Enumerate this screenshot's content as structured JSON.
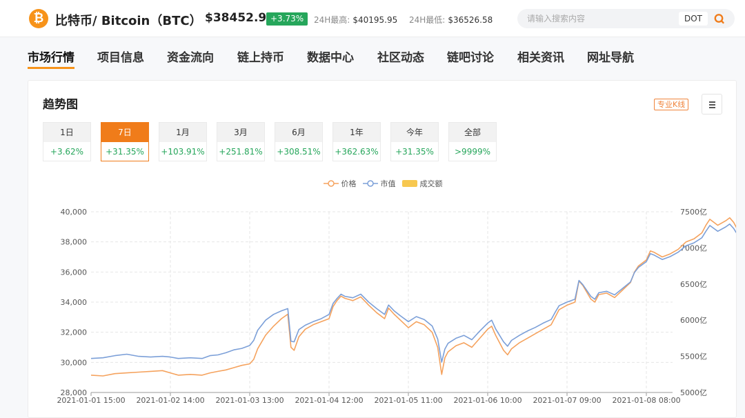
{
  "header": {
    "logo_symbol": "₿",
    "coin_name": "比特币/ Bitcoin（BTC）",
    "price": "$38452.91",
    "change": "+3.73%",
    "high_label": "24H最高:",
    "high_value": "$40195.95",
    "low_label": "24H最低:",
    "low_value": "$36526.58",
    "search_placeholder": "请输入搜索内容",
    "search_coin": "DOT",
    "search_icon": "search-icon"
  },
  "nav": {
    "items": [
      "市场行情",
      "项目信息",
      "资金流向",
      "链上持币",
      "数据中心",
      "社区动态",
      "链吧讨论",
      "相关资讯",
      "网址导航"
    ]
  },
  "panel": {
    "title": "趋势图",
    "kline_label": "专业K线",
    "menu_icon": "menu-icon"
  },
  "ranges": [
    {
      "label": "1日",
      "change": "+3.62%"
    },
    {
      "label": "7日",
      "change": "+31.35%",
      "active": true
    },
    {
      "label": "1月",
      "change": "+103.91%"
    },
    {
      "label": "3月",
      "change": "+251.81%"
    },
    {
      "label": "6月",
      "change": "+308.51%"
    },
    {
      "label": "1年",
      "change": "+362.63%"
    },
    {
      "label": "今年",
      "change": "+31.35%"
    },
    {
      "label": "全部",
      "change": ">9999%"
    }
  ],
  "colors": {
    "price": "#f5a25d",
    "market_cap": "#7b9fd8",
    "volume": "#f7c850",
    "accent": "#f07c1a",
    "up": "#26a65b"
  },
  "chart_data": {
    "type": "line",
    "legend": [
      "价格",
      "市值",
      "成交额"
    ],
    "x_ticks": [
      "2021-01-01 15:00",
      "2021-01-02 14:00",
      "2021-01-03 13:00",
      "2021-01-04 12:00",
      "2021-01-05 11:00",
      "2021-01-06 10:00",
      "2021-01-07 09:00",
      "2021-01-08 08:00"
    ],
    "y_ticks": [
      "28,000",
      "30,000",
      "32,000",
      "34,000",
      "36,000",
      "38,000",
      "40,000"
    ],
    "y2_ticks": [
      "5000亿",
      "5500亿",
      "6000亿",
      "6500亿",
      "7000亿",
      "7500亿"
    ],
    "ylim": [
      28000,
      40000
    ],
    "y2lim": [
      5000,
      7500
    ],
    "x_range": [
      0,
      7.25
    ],
    "series": [
      {
        "name": "价格",
        "axis": "left",
        "points": [
          [
            0,
            29150
          ],
          [
            0.15,
            29100
          ],
          [
            0.3,
            29250
          ],
          [
            0.45,
            29300
          ],
          [
            0.6,
            29350
          ],
          [
            0.75,
            29400
          ],
          [
            0.9,
            29450
          ],
          [
            1.0,
            29300
          ],
          [
            1.1,
            29150
          ],
          [
            1.25,
            29200
          ],
          [
            1.4,
            29150
          ],
          [
            1.5,
            29300
          ],
          [
            1.6,
            29400
          ],
          [
            1.7,
            29500
          ],
          [
            1.8,
            29650
          ],
          [
            1.9,
            29800
          ],
          [
            2.0,
            29900
          ],
          [
            2.05,
            30200
          ],
          [
            2.1,
            30900
          ],
          [
            2.2,
            31800
          ],
          [
            2.3,
            32400
          ],
          [
            2.4,
            32900
          ],
          [
            2.48,
            33200
          ],
          [
            2.52,
            31000
          ],
          [
            2.56,
            30800
          ],
          [
            2.62,
            31700
          ],
          [
            2.7,
            32200
          ],
          [
            2.8,
            32500
          ],
          [
            2.9,
            32700
          ],
          [
            3.0,
            32900
          ],
          [
            3.05,
            33700
          ],
          [
            3.1,
            34100
          ],
          [
            3.15,
            34400
          ],
          [
            3.2,
            34250
          ],
          [
            3.3,
            34100
          ],
          [
            3.4,
            34350
          ],
          [
            3.5,
            33800
          ],
          [
            3.6,
            33300
          ],
          [
            3.7,
            32900
          ],
          [
            3.75,
            33600
          ],
          [
            3.82,
            33200
          ],
          [
            3.9,
            32800
          ],
          [
            4.0,
            32300
          ],
          [
            4.1,
            32700
          ],
          [
            4.2,
            32500
          ],
          [
            4.3,
            32000
          ],
          [
            4.37,
            31000
          ],
          [
            4.42,
            29200
          ],
          [
            4.46,
            30300
          ],
          [
            4.5,
            30700
          ],
          [
            4.6,
            31100
          ],
          [
            4.7,
            31300
          ],
          [
            4.8,
            31000
          ],
          [
            4.9,
            31600
          ],
          [
            5.0,
            32200
          ],
          [
            5.05,
            32400
          ],
          [
            5.1,
            31800
          ],
          [
            5.2,
            30800
          ],
          [
            5.25,
            30500
          ],
          [
            5.3,
            30900
          ],
          [
            5.4,
            31300
          ],
          [
            5.5,
            31600
          ],
          [
            5.6,
            31900
          ],
          [
            5.7,
            32200
          ],
          [
            5.8,
            32500
          ],
          [
            5.85,
            33000
          ],
          [
            5.9,
            33500
          ],
          [
            6.0,
            33800
          ],
          [
            6.05,
            33900
          ],
          [
            6.1,
            34000
          ],
          [
            6.15,
            35400
          ],
          [
            6.2,
            35100
          ],
          [
            6.3,
            34200
          ],
          [
            6.35,
            34000
          ],
          [
            6.4,
            34500
          ],
          [
            6.5,
            34600
          ],
          [
            6.6,
            34300
          ],
          [
            6.7,
            34800
          ],
          [
            6.8,
            35300
          ],
          [
            6.85,
            36000
          ],
          [
            6.9,
            36400
          ],
          [
            7.0,
            36800
          ],
          [
            7.05,
            37400
          ],
          [
            7.1,
            37300
          ],
          [
            7.2,
            37000
          ],
          [
            7.3,
            37200
          ],
          [
            7.4,
            37500
          ],
          [
            7.5,
            38000
          ],
          [
            7.6,
            38200
          ],
          [
            7.7,
            38600
          ],
          [
            7.75,
            39100
          ],
          [
            7.8,
            39500
          ],
          [
            7.85,
            39300
          ],
          [
            7.9,
            39100
          ],
          [
            8.0,
            39400
          ],
          [
            8.05,
            39600
          ],
          [
            8.1,
            39300
          ],
          [
            8.15,
            38800
          ],
          [
            8.2,
            37200
          ],
          [
            8.25,
            37800
          ],
          [
            8.3,
            38500
          ],
          [
            8.35,
            38200
          ],
          [
            8.4,
            38600
          ]
        ]
      },
      {
        "name": "市值",
        "axis": "right",
        "points": [
          [
            0,
            5470
          ],
          [
            0.15,
            5480
          ],
          [
            0.3,
            5510
          ],
          [
            0.45,
            5530
          ],
          [
            0.6,
            5500
          ],
          [
            0.75,
            5490
          ],
          [
            0.9,
            5500
          ],
          [
            1.0,
            5490
          ],
          [
            1.1,
            5470
          ],
          [
            1.25,
            5480
          ],
          [
            1.4,
            5470
          ],
          [
            1.5,
            5510
          ],
          [
            1.6,
            5520
          ],
          [
            1.7,
            5550
          ],
          [
            1.8,
            5590
          ],
          [
            1.9,
            5610
          ],
          [
            2.0,
            5650
          ],
          [
            2.05,
            5720
          ],
          [
            2.1,
            5860
          ],
          [
            2.2,
            6000
          ],
          [
            2.3,
            6080
          ],
          [
            2.4,
            6130
          ],
          [
            2.48,
            6160
          ],
          [
            2.52,
            5710
          ],
          [
            2.56,
            5700
          ],
          [
            2.62,
            5870
          ],
          [
            2.7,
            5930
          ],
          [
            2.8,
            5980
          ],
          [
            2.9,
            6020
          ],
          [
            3.0,
            6080
          ],
          [
            3.05,
            6230
          ],
          [
            3.1,
            6300
          ],
          [
            3.15,
            6360
          ],
          [
            3.2,
            6330
          ],
          [
            3.3,
            6310
          ],
          [
            3.4,
            6360
          ],
          [
            3.5,
            6250
          ],
          [
            3.6,
            6160
          ],
          [
            3.7,
            6080
          ],
          [
            3.75,
            6210
          ],
          [
            3.82,
            6130
          ],
          [
            3.9,
            6060
          ],
          [
            4.0,
            5980
          ],
          [
            4.1,
            6050
          ],
          [
            4.2,
            6010
          ],
          [
            4.3,
            5920
          ],
          [
            4.37,
            5740
          ],
          [
            4.42,
            5420
          ],
          [
            4.46,
            5600
          ],
          [
            4.5,
            5680
          ],
          [
            4.6,
            5750
          ],
          [
            4.7,
            5790
          ],
          [
            4.8,
            5730
          ],
          [
            4.9,
            5850
          ],
          [
            5.0,
            5960
          ],
          [
            5.05,
            6000
          ],
          [
            5.1,
            5880
          ],
          [
            5.2,
            5700
          ],
          [
            5.25,
            5640
          ],
          [
            5.3,
            5720
          ],
          [
            5.4,
            5790
          ],
          [
            5.5,
            5850
          ],
          [
            5.6,
            5900
          ],
          [
            5.7,
            5960
          ],
          [
            5.8,
            6010
          ],
          [
            5.85,
            6110
          ],
          [
            5.9,
            6200
          ],
          [
            6.0,
            6250
          ],
          [
            6.05,
            6270
          ],
          [
            6.1,
            6290
          ],
          [
            6.15,
            6550
          ],
          [
            6.2,
            6490
          ],
          [
            6.3,
            6330
          ],
          [
            6.35,
            6290
          ],
          [
            6.4,
            6380
          ],
          [
            6.5,
            6400
          ],
          [
            6.6,
            6350
          ],
          [
            6.7,
            6440
          ],
          [
            6.8,
            6530
          ],
          [
            6.85,
            6660
          ],
          [
            6.9,
            6730
          ],
          [
            7.0,
            6810
          ],
          [
            7.05,
            6920
          ],
          [
            7.1,
            6900
          ],
          [
            7.2,
            6840
          ],
          [
            7.3,
            6880
          ],
          [
            7.4,
            6940
          ],
          [
            7.5,
            7030
          ],
          [
            7.6,
            7070
          ],
          [
            7.7,
            7140
          ],
          [
            7.75,
            7230
          ],
          [
            7.8,
            7310
          ],
          [
            7.85,
            7270
          ],
          [
            7.9,
            7230
          ],
          [
            8.0,
            7290
          ],
          [
            8.05,
            7330
          ],
          [
            8.1,
            7270
          ],
          [
            8.15,
            7180
          ],
          [
            8.2,
            6880
          ],
          [
            8.25,
            6990
          ],
          [
            8.3,
            7120
          ],
          [
            8.35,
            7060
          ],
          [
            8.4,
            7140
          ]
        ]
      }
    ]
  }
}
